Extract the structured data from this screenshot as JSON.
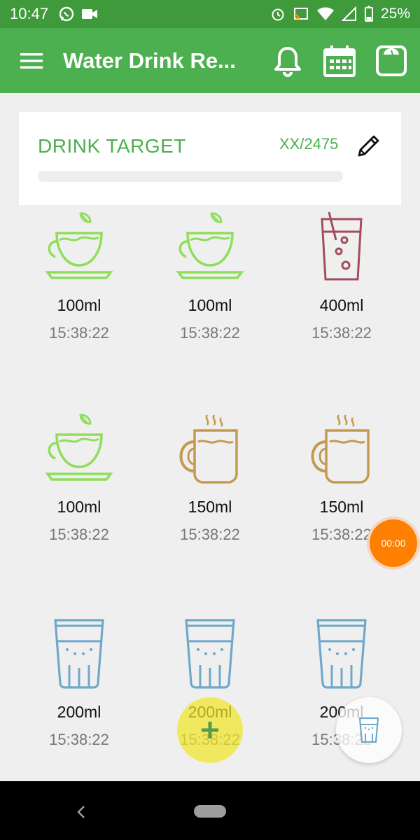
{
  "status_bar": {
    "time": "10:47",
    "battery": "25%",
    "left_icons": [
      "whatsapp-icon",
      "video-camera-icon"
    ],
    "right_icons": [
      "alarm-icon",
      "cast-icon",
      "wifi-icon",
      "no-signal-icon",
      "battery-icon"
    ]
  },
  "app_bar": {
    "title": "Water Drink Re...",
    "actions": [
      "bell-icon",
      "calendar-icon",
      "scale-icon"
    ]
  },
  "target": {
    "label": "DRINK TARGET",
    "value": "XX/2475",
    "progress": 0
  },
  "drinks": [
    {
      "amount": "100ml",
      "time": "15:38:22",
      "icon": "tea-cup-icon",
      "color": "#8fde5a"
    },
    {
      "amount": "100ml",
      "time": "15:38:22",
      "icon": "tea-cup-icon",
      "color": "#8fde5a"
    },
    {
      "amount": "400ml",
      "time": "15:38:22",
      "icon": "soda-glass-icon",
      "color": "#a24d5c"
    },
    {
      "amount": "100ml",
      "time": "15:38:22",
      "icon": "tea-cup-icon",
      "color": "#8fde5a"
    },
    {
      "amount": "150ml",
      "time": "15:38:22",
      "icon": "hot-mug-icon",
      "color": "#c59a4e"
    },
    {
      "amount": "150ml",
      "time": "15:38:22",
      "icon": "hot-mug-icon",
      "color": "#c59a4e"
    },
    {
      "amount": "200ml",
      "time": "15:38:22",
      "icon": "water-glass-icon",
      "color": "#6fa8c9"
    },
    {
      "amount": "200ml",
      "time": "15:38:22",
      "icon": "water-glass-icon",
      "color": "#6fa8c9"
    },
    {
      "amount": "200ml",
      "time": "15:38:22",
      "icon": "water-glass-icon",
      "color": "#6fa8c9"
    }
  ],
  "timer": {
    "label": "00:00"
  },
  "colors": {
    "primary": "#4caf50",
    "primary_dark": "#3f9a3c",
    "timer": "#ff7f00",
    "fab_add": "#f0e628"
  }
}
